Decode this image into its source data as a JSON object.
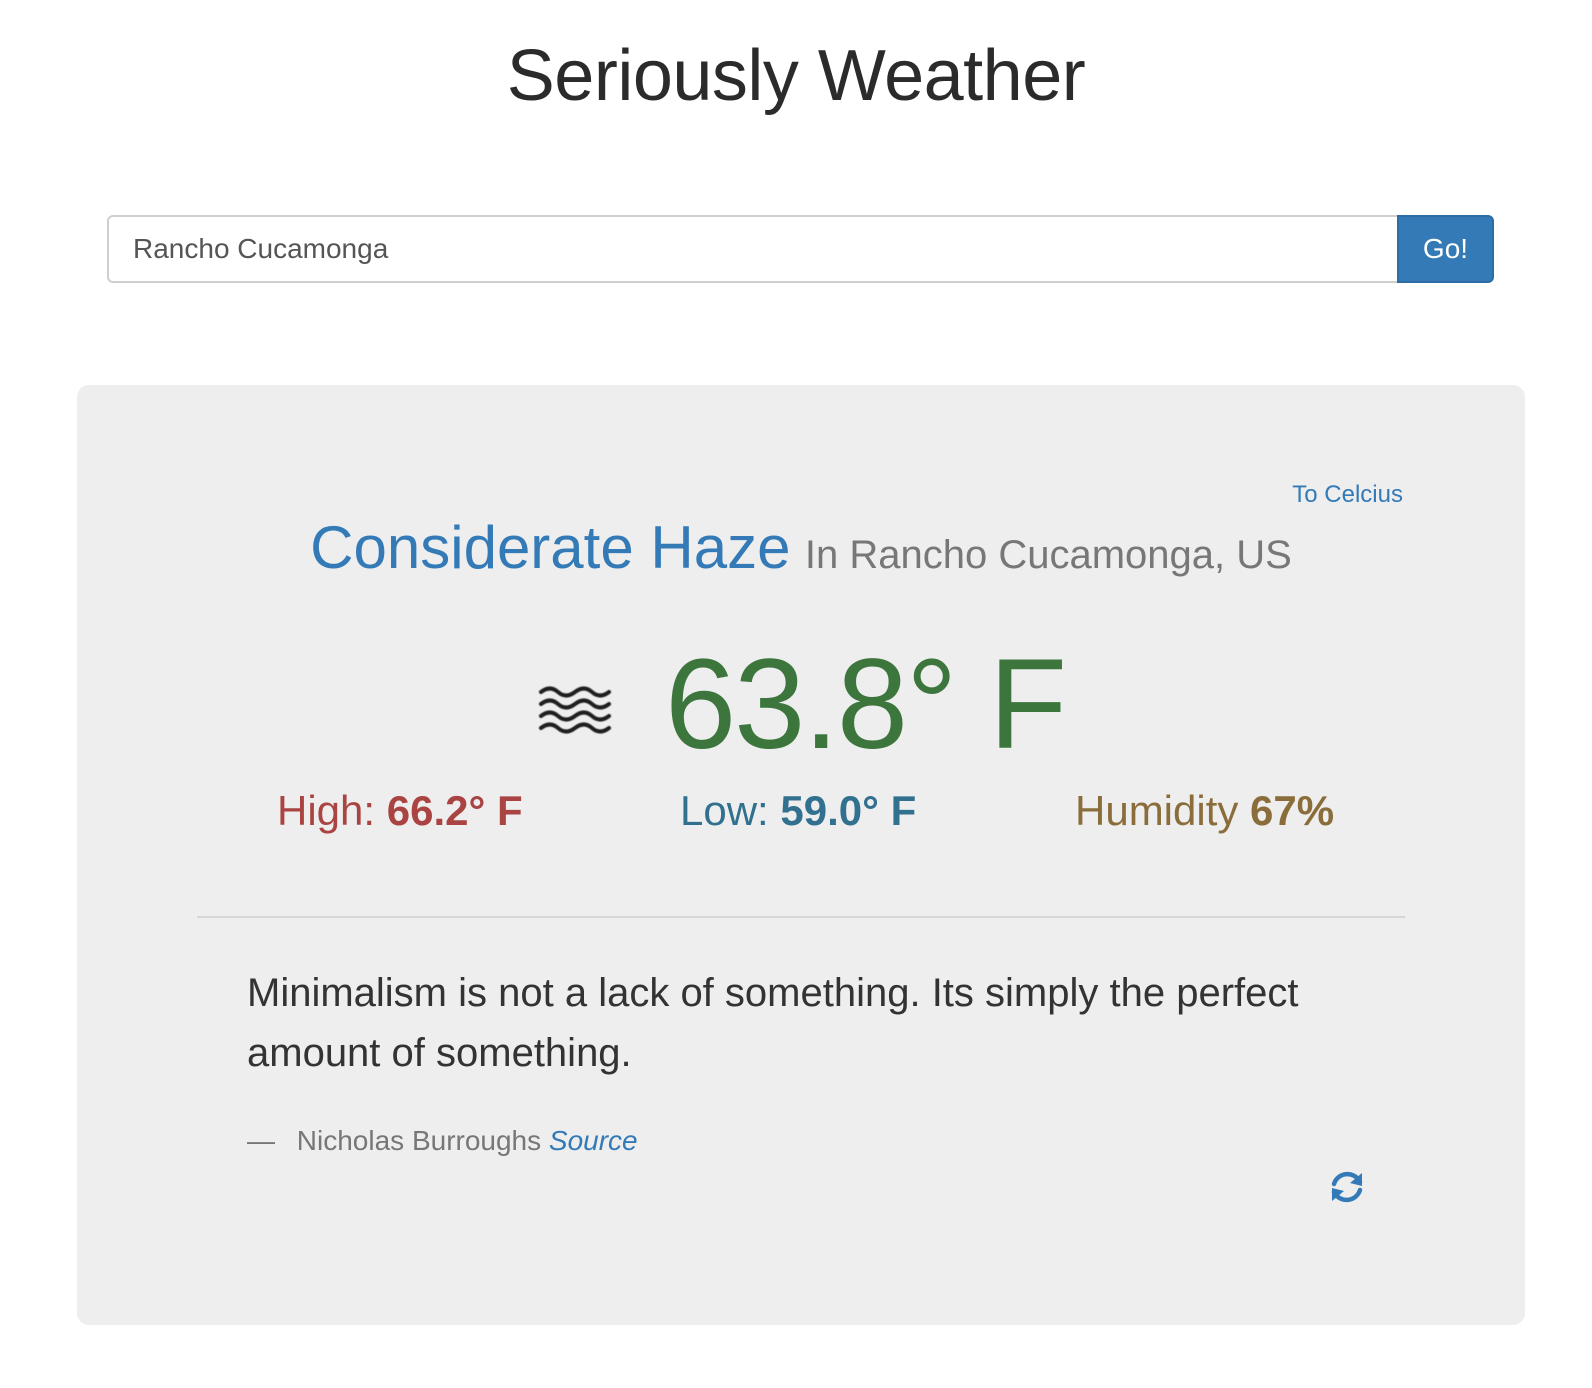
{
  "header": {
    "title": "Seriously Weather"
  },
  "search": {
    "value": "Rancho Cucamonga",
    "button_label": "Go!"
  },
  "weather": {
    "unit_toggle_label": "To Celcius",
    "condition_name": "Considerate Haze",
    "location": "In Rancho Cucamonga, US",
    "icon": "haze-icon",
    "temperature": "63.8° F",
    "high_label": "High:",
    "high_value": "66.2° F",
    "low_label": "Low:",
    "low_value": "59.0° F",
    "humidity_label": "Humidity",
    "humidity_value": "67%"
  },
  "quote": {
    "text": "Minimalism is not a lack of something. Its simply the perfect amount of something.",
    "dash": "—",
    "author": "Nicholas Burroughs",
    "source_label": "Source",
    "refresh_icon": "refresh-icon"
  },
  "colors": {
    "primary": "#337ab7",
    "temperature": "#3c763d",
    "high": "#a94442",
    "low": "#31708f",
    "humidity": "#8a6d3b",
    "card_background": "#eeeeee"
  }
}
